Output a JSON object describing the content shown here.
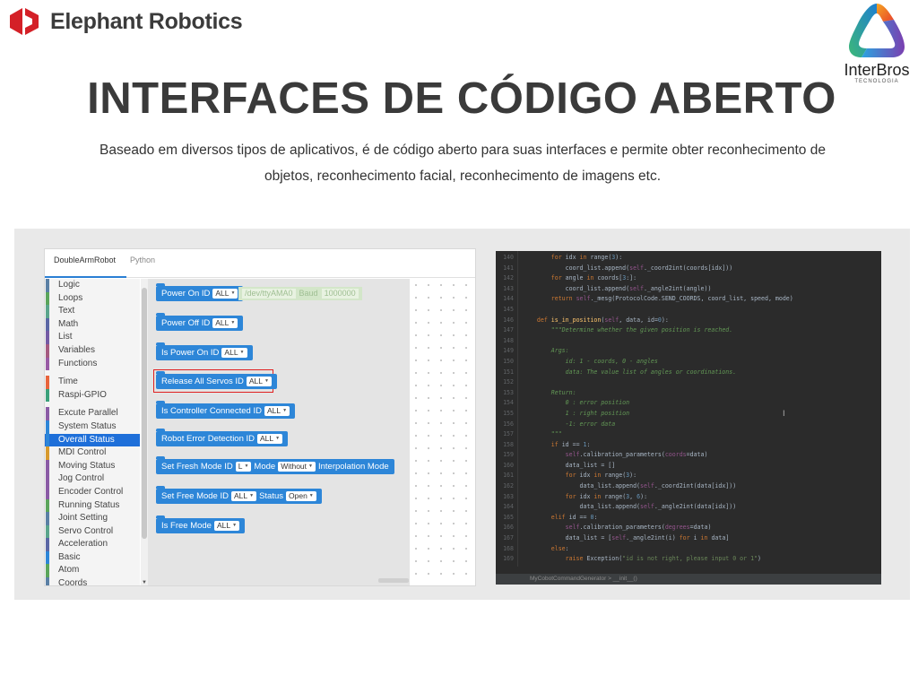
{
  "header": {
    "brand_name": "Elephant Robotics",
    "partner_name": "InterBros",
    "partner_tagline": "TECNOLOGIA",
    "title": "INTERFACES DE CÓDIGO ABERTO",
    "subtitle_line1": "Baseado em diversos tipos de aplicativos, é de código aberto para suas interfaces e permite obter reconhecimento de",
    "subtitle_line2": "objetos, reconhecimento facial, reconhecimento de imagens etc."
  },
  "editor": {
    "tabs": [
      "DoubleArmRobot",
      "Python"
    ],
    "active_tab": "DoubleArmRobot",
    "categories": [
      {
        "label": "Logic",
        "color": "#5b80a5"
      },
      {
        "label": "Loops",
        "color": "#5ba55b"
      },
      {
        "label": "Text",
        "color": "#5ba58c"
      },
      {
        "label": "Math",
        "color": "#5b67a5"
      },
      {
        "label": "List",
        "color": "#745ba5"
      },
      {
        "label": "Variables",
        "color": "#a55b80"
      },
      {
        "label": "Functions",
        "color": "#995ba5"
      },
      {
        "label": "Time",
        "color": "#e8643c"
      },
      {
        "label": "Raspi-GPIO",
        "color": "#3aa07a"
      },
      {
        "label": "Excute Parallel",
        "color": "#8a5ba5"
      },
      {
        "label": "System Status",
        "color": "#2d86d8"
      },
      {
        "label": "Overall Status",
        "color": "#2d86d8"
      },
      {
        "label": "MDI Control",
        "color": "#d89a2d"
      },
      {
        "label": "Moving Status",
        "color": "#8a5ba5"
      },
      {
        "label": "Jog Control",
        "color": "#8a5ba5"
      },
      {
        "label": "Encoder Control",
        "color": "#8a5ba5"
      },
      {
        "label": "Running Status",
        "color": "#5ba55b"
      },
      {
        "label": "Joint Setting",
        "color": "#5b80a5"
      },
      {
        "label": "Servo Control",
        "color": "#5ba58c"
      },
      {
        "label": "Acceleration",
        "color": "#5b67a5"
      },
      {
        "label": "Basic",
        "color": "#2d86d8"
      },
      {
        "label": "Atom",
        "color": "#5ba55b"
      },
      {
        "label": "Coords",
        "color": "#5b80a5"
      }
    ],
    "selected_category": "Overall Status",
    "blocks": {
      "power_on": {
        "label": "Power On ID",
        "id": "ALL"
      },
      "ghost": {
        "port": "/dev/ttyAMA0",
        "baud_label": "Baud",
        "baud": "1000000"
      },
      "power_off": {
        "label": "Power Off ID",
        "id": "ALL"
      },
      "is_power_on": {
        "label": "Is Power On ID",
        "id": "ALL"
      },
      "release_servos": {
        "label": "Release All Servos ID",
        "id": "ALL"
      },
      "is_controller": {
        "label": "Is Controller Connected ID",
        "id": "ALL"
      },
      "robot_error": {
        "label": "Robot Error Detection ID",
        "id": "ALL"
      },
      "set_fresh": {
        "label": "Set Fresh Mode ID",
        "id": "L",
        "mode_label": "Mode",
        "mode": "Without",
        "interp_label": "Interpolation Mode"
      },
      "set_free": {
        "label": "Set Free Mode ID",
        "id": "ALL",
        "status_label": "Status",
        "status": "Open"
      },
      "is_free": {
        "label": "Is Free Mode",
        "id": "ALL"
      }
    }
  },
  "code": {
    "line_numbers": [
      "140",
      "141",
      "142",
      "143",
      "144",
      "145",
      "146",
      "147",
      "148",
      "149",
      "150",
      "151",
      "152",
      "153",
      "154",
      "155",
      "156",
      "157",
      "158",
      "159",
      "160",
      "161",
      "162",
      "163",
      "164",
      "165",
      "166",
      "167",
      "168",
      "169"
    ],
    "status_path": "MyCobotCommandGenerator  >  __init__()"
  },
  "colors": {
    "accent_blue": "#2d86d8",
    "brand_red": "#d42027",
    "highlight_red": "#e02020",
    "code_bg": "#2b2b2b"
  }
}
